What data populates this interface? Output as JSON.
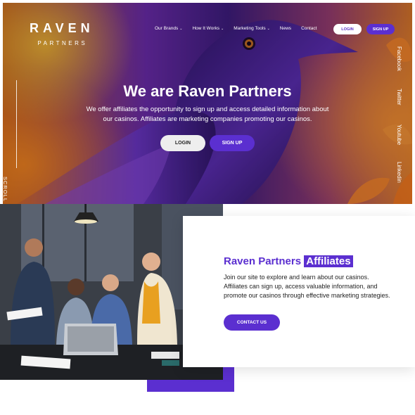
{
  "logo": {
    "main": "RAVEN",
    "sub": "PARTNERS"
  },
  "nav": {
    "items": [
      {
        "label": "Our Brands",
        "dropdown": true
      },
      {
        "label": "How It Works",
        "dropdown": true
      },
      {
        "label": "Marketing Tools",
        "dropdown": true
      },
      {
        "label": "News",
        "dropdown": false
      },
      {
        "label": "Contact",
        "dropdown": false
      }
    ],
    "login": "LOGIN",
    "signup": "SIGN UP",
    "chevron": "⌄"
  },
  "hero": {
    "title": "We are Raven Partners",
    "description": "We offer affiliates the opportunity to sign up and access detailed information about our casinos. Affiliates are marketing companies promoting our casinos.",
    "login": "LOGIN",
    "signup": "SIGN UP",
    "scroll": "SCROLL"
  },
  "social": [
    "Facebook",
    "Twitter",
    "Youtube",
    "Linkedin"
  ],
  "affiliates": {
    "title_main": "Raven Partners",
    "title_highlight": "Affiliates",
    "description": "Join our site to explore and learn about our casinos. Affiliates can sign up, access valuable information, and promote our casinos through effective marketing strategies.",
    "button": "CONTACT US"
  },
  "colors": {
    "accent": "#5b2fd0",
    "hero_orange": "#e07a20",
    "hero_purple": "#3b1a7a"
  }
}
